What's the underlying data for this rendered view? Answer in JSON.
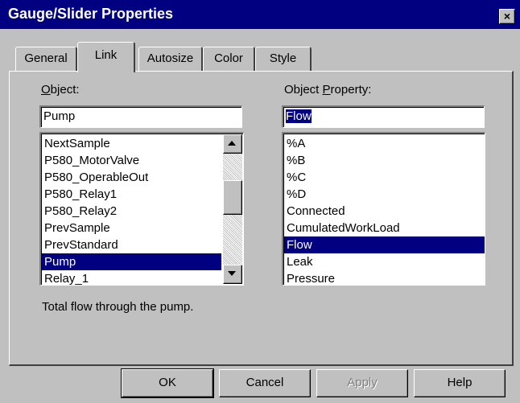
{
  "window": {
    "title": "Gauge/Slider Properties",
    "close_glyph": "×"
  },
  "tabs": [
    {
      "label": "General",
      "active": false
    },
    {
      "label": "Link",
      "active": true
    },
    {
      "label": "Autosize",
      "active": false
    },
    {
      "label": "Color",
      "active": false
    },
    {
      "label": "Style",
      "active": false
    }
  ],
  "object": {
    "label": "Object:",
    "value": "Pump",
    "items": [
      "NextSample",
      "P580_MotorValve",
      "P580_OperableOut",
      "P580_Relay1",
      "P580_Relay2",
      "PrevSample",
      "PrevStandard",
      "Pump",
      "Relay_1"
    ],
    "selected_index": 7
  },
  "property": {
    "label": "Object Property:",
    "value": "Flow",
    "items": [
      "%A",
      "%B",
      "%C",
      "%D",
      "Connected",
      "CumulatedWorkLoad",
      "Flow",
      "Leak",
      "Pressure"
    ],
    "selected_index": 6
  },
  "description": "Total flow through the pump.",
  "buttons": {
    "ok": "OK",
    "cancel": "Cancel",
    "apply": "Apply",
    "help": "Help"
  },
  "colors": {
    "title_bar": "#000080",
    "face": "#c0c0c0",
    "selection": "#000080"
  }
}
